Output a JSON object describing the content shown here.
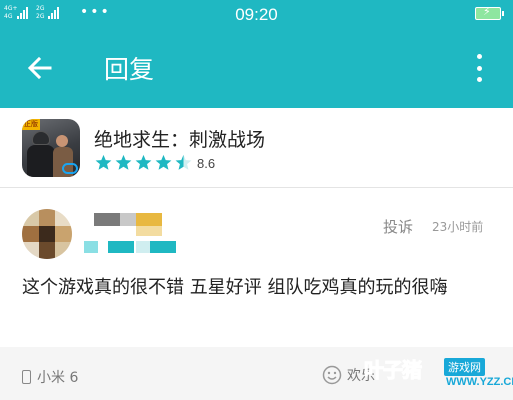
{
  "status_bar": {
    "time": "09:20",
    "network_tags": [
      "4G+",
      "4G",
      "2G",
      "2G"
    ],
    "more_dots": "•••"
  },
  "header": {
    "title": "回复"
  },
  "app": {
    "name": "绝地求生：刺激战场",
    "rating": "8.6",
    "rating_value": 4.5,
    "icon_badge": "正版"
  },
  "comment": {
    "report_label": "投诉",
    "time": "23小时前",
    "text": "这个游戏真的很不错 五星好评 组队吃鸡真的玩的很嗨"
  },
  "footer": {
    "device": "小米 6",
    "emoji_label": "欢乐"
  },
  "watermark": {
    "brand": "叶子猪",
    "tag": "游戏网",
    "url": "WWW.YZZ.CN"
  },
  "colors": {
    "accent": "#1fb8c2",
    "star": "#1fb8c2",
    "watermark": "#18a8d8"
  }
}
